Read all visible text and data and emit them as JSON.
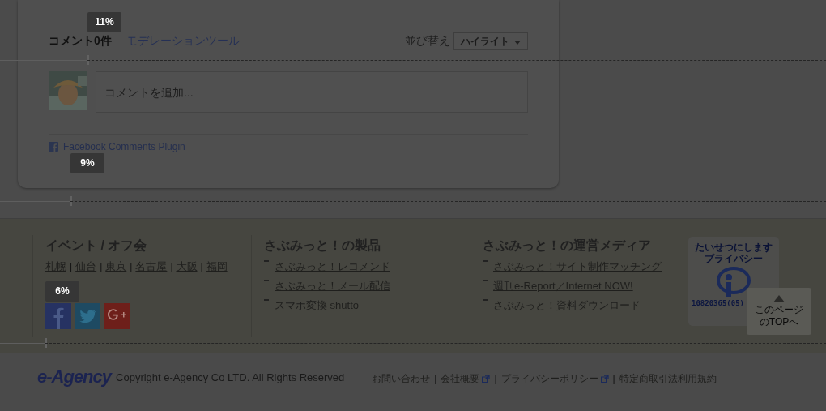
{
  "comments": {
    "count_label": "コメント0件",
    "moderation_link": "モデレーションツール",
    "sort_label": "並び替え",
    "sort_value": "ハイライト",
    "input": {
      "placeholder": "コメントを追加..."
    },
    "plugin_label": "Facebook Comments Plugin"
  },
  "footer": {
    "columns": [
      {
        "kind": "inline",
        "heading": "イベント / オフ会",
        "separator": "|",
        "links": [
          "札幌",
          "仙台",
          "東京",
          "名古屋",
          "大阪",
          "福岡"
        ]
      },
      {
        "kind": "list",
        "heading": "さぶみっと！の製品",
        "links": [
          "さぶみっと！レコメンド",
          "さぶみっと！メール配信",
          "スマホ変換 shutto"
        ]
      },
      {
        "kind": "list",
        "heading": "さぶみっと！の運営メディア",
        "links": [
          "さぶみっと！サイト制作マッチング",
          "週刊e-Report／Internet NOW!",
          "さぶみっと！資料ダウンロード"
        ]
      }
    ],
    "privacy_mark": {
      "arc_text": "たいせつにしますプライバシー",
      "number": "10820365(05)"
    },
    "top_button": "このページのTOPへ"
  },
  "bottom_bar": {
    "logo": "e-Agency",
    "copyright": "Copyright e-Agency Co LTD. All Rights Reserved",
    "separator": "|",
    "links": [
      {
        "label": "お問い合わせ",
        "external": false
      },
      {
        "label": "会社概要",
        "external": true
      },
      {
        "label": "プライバシーポリシー",
        "external": true
      },
      {
        "label": "特定商取引法利用規約",
        "external": false
      }
    ]
  },
  "scroll_markers": [
    {
      "label": "11%"
    },
    {
      "label": "9%"
    },
    {
      "label": "6%"
    }
  ]
}
